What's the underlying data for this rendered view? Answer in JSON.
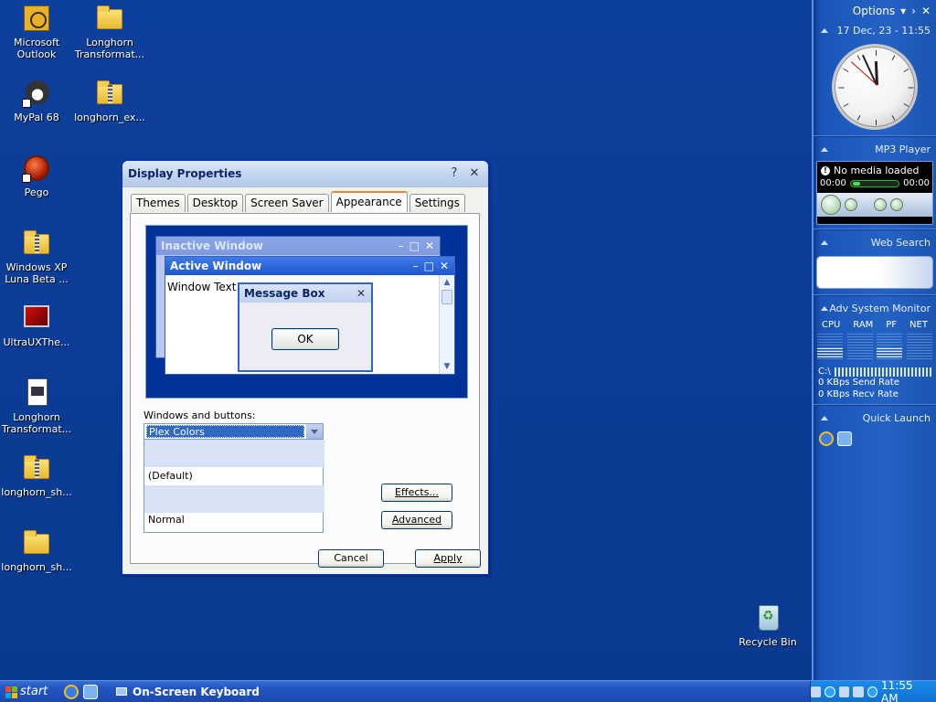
{
  "desktop": {
    "icons": [
      {
        "label": "Microsoft Outlook",
        "icon": "outlook-icon"
      },
      {
        "label": "Longhorn Transformat...",
        "icon": "folder-icon"
      },
      {
        "label": "MyPal 68",
        "icon": "mypal-browser-icon"
      },
      {
        "label": "longhorn_ex...",
        "icon": "zip-folder-icon"
      },
      {
        "label": "Pego",
        "icon": "pego-icon"
      },
      {
        "label": "Windows XP Luna Beta ...",
        "icon": "zip-folder-icon"
      },
      {
        "label": "UltraUXThe...",
        "icon": "ultraux-icon"
      },
      {
        "label": "Longhorn Transformat...",
        "icon": "document-icon"
      },
      {
        "label": "longhorn_sh...",
        "icon": "zip-folder-icon"
      },
      {
        "label": "longhorn_sh...",
        "icon": "folder-icon"
      },
      {
        "label": "Recycle Bin",
        "icon": "recycle-bin-icon"
      }
    ]
  },
  "sidebar": {
    "options_label": "Options",
    "datetime": "17 Dec, 23 - 11:55",
    "clock": {
      "hour": 11,
      "minute": 55,
      "second": 52
    },
    "mp3": {
      "title": "MP3 Player",
      "status": "No media loaded",
      "time_start": "00:00",
      "time_end": "00:00"
    },
    "web_search_title": "Web Search",
    "monitor": {
      "title": "Adv System Monitor",
      "columns": [
        "CPU",
        "RAM",
        "PF",
        "NET"
      ],
      "drive": "C:\\",
      "send_rate": "0 KBps Send Rate",
      "recv_rate": "0 KBps Recv Rate"
    },
    "quick_launch_title": "Quick Launch"
  },
  "window": {
    "title": "Display Properties",
    "help_glyph": "?",
    "close_glyph": "✕",
    "tabs": [
      "Themes",
      "Desktop",
      "Screen Saver",
      "Appearance",
      "Settings"
    ],
    "active_tab": "Appearance",
    "preview": {
      "inactive_title": "Inactive Window",
      "active_title": "Active Window",
      "window_text": "Window Text",
      "msgbox_title": "Message Box",
      "ok_label": "OK"
    },
    "windows_buttons_label": "Windows and buttons:",
    "combo_value": "Plex Colors",
    "dropdown_items": [
      "(Default)",
      "Normal"
    ],
    "effects_label": "Effects...",
    "advanced_label": "Advanced",
    "cancel_label": "Cancel",
    "apply_label": "Apply"
  },
  "taskbar": {
    "start_label": "start",
    "task_label": "On-Screen Keyboard",
    "time": "11:55 AM"
  }
}
